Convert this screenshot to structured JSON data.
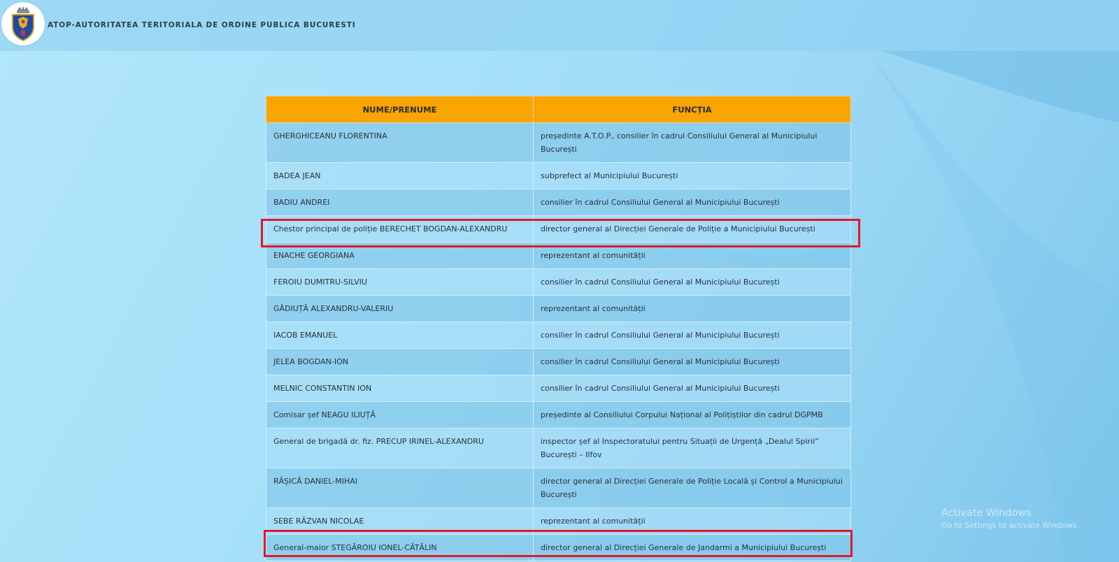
{
  "header": {
    "title": "ATOP-AUTORITATEA TERITORIALA DE ORDINE PUBLICA BUCURESTI",
    "logo_icon": "bucharest-coat-of-arms-icon"
  },
  "table": {
    "columns": [
      "NUME/PRENUME",
      "FUNCȚIA"
    ],
    "rows": [
      {
        "name": "GHERGHICEANU FLORENTINA",
        "role": "președinte A.T.O.P., consilier în cadrul Consiliului General al Municipiului București"
      },
      {
        "name": "BADEA JEAN",
        "role": "subprefect al Municipiului București"
      },
      {
        "name": "BADIU ANDREI",
        "role": "consilier în cadrul Consiliului General al Municipiului București"
      },
      {
        "name": "Chestor principal de poliție  BERECHET BOGDAN-ALEXANDRU",
        "role": "director general al Direcției Generale de Poliție a Municipiului București"
      },
      {
        "name": "ENACHE GEORGIANA",
        "role": "reprezentant al comunității"
      },
      {
        "name": "FEROIU DUMITRU-SILVIU",
        "role": "consilier în cadrul Consiliului General al Municipiului București"
      },
      {
        "name": "GÂDIUȚĂ ALEXANDRU-VALERIU",
        "role": "reprezentant al comunității"
      },
      {
        "name": "IACOB EMANUEL",
        "role": "consilier în cadrul Consiliului General al Municipiului București"
      },
      {
        "name": "JELEA BOGDAN-ION",
        "role": "consilier în cadrul Consiliului General al Municipiului București"
      },
      {
        "name": "MELNIC CONSTANTIN ION",
        "role": "consilier în cadrul Consiliului General al Municipiului București"
      },
      {
        "name": "Comisar șef NEAGU ILIUȚĂ",
        "role": "președinte al Consiliului Corpului Național al Polițiștilor din cadrul DGPMB"
      },
      {
        "name": "General de brigadă dr. fiz. PRECUP IRINEL-ALEXANDRU",
        "role": "inspector șef al Inspectoratului pentru Situații de Urgență „Dealul Spirii” București – Ilfov"
      },
      {
        "name": "RĂȘICĂ DANIEL-MIHAI",
        "role": "director general al Direcției Generale de Poliție Locală și Control a Municipiului București"
      },
      {
        "name": "SEBE RĂZVAN NICOLAE",
        "role": "reprezentant al comunității"
      },
      {
        "name": "General-maior STEGĂROIU IONEL-CĂTĂLIN",
        "role": "director general al Direcției Generale de Jandarmi a Municipiului București"
      }
    ]
  },
  "highlight_color": "#e2182b",
  "header_color": "#f9a602",
  "watermark": {
    "title": "Activate Windows",
    "subtitle": "Go to Settings to activate Windows."
  }
}
